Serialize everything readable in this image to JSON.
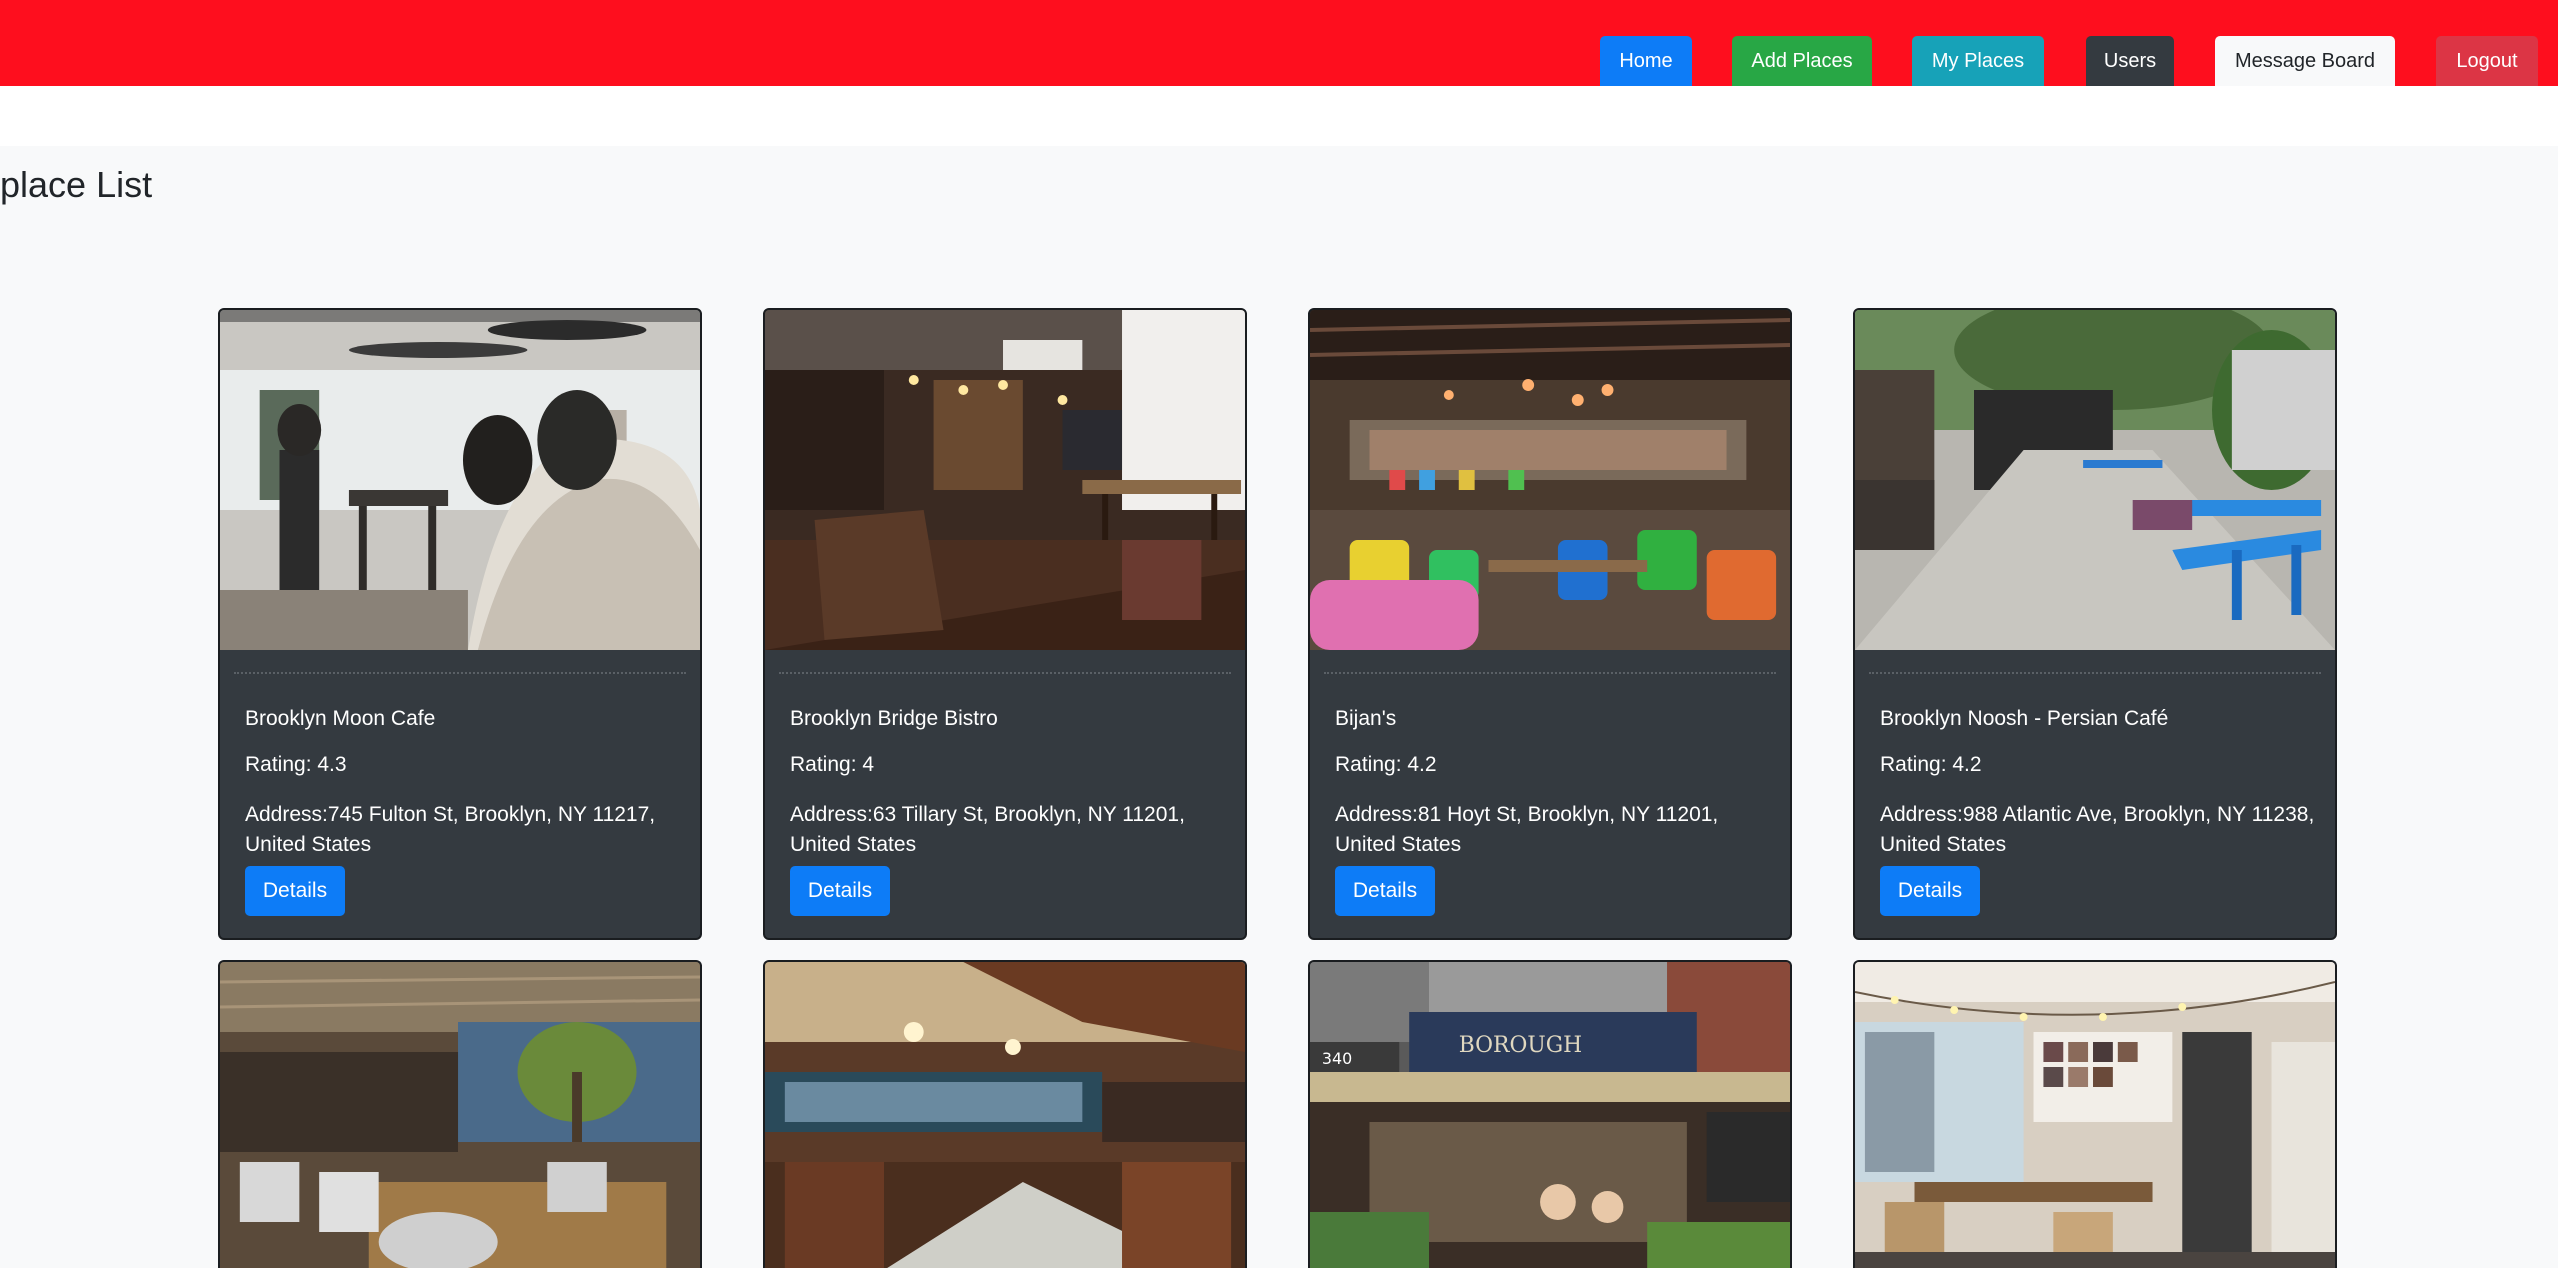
{
  "nav": {
    "home": "Home",
    "add_places": "Add Places",
    "my_places": "My Places",
    "users": "Users",
    "message_board": "Message Board",
    "logout": "Logout"
  },
  "page": {
    "title": "place List"
  },
  "places": [
    {
      "name": "Brooklyn Moon Cafe",
      "rating": "Rating: 4.3",
      "address": "Address:745 Fulton St, Brooklyn, NY 11217, United States",
      "details": "Details"
    },
    {
      "name": "Brooklyn Bridge Bistro",
      "rating": "Rating: 4",
      "address": "Address:63 Tillary St, Brooklyn, NY 11201, United States",
      "details": "Details"
    },
    {
      "name": "Bijan's",
      "rating": "Rating: 4.2",
      "address": "Address:81 Hoyt St, Brooklyn, NY 11201, United States",
      "details": "Details"
    },
    {
      "name": "Brooklyn Noosh - Persian Café",
      "rating": "Rating: 4.2",
      "address": "Address:988 Atlantic Ave, Brooklyn, NY 11238, United States",
      "details": "Details"
    }
  ],
  "photo_signs": {
    "storefront_number": "340",
    "storefront_name": "BOROUGH"
  },
  "colors": {
    "header": "#fe0e1e",
    "card": "#343a40",
    "primary": "#0d7cf7",
    "success": "#28a745",
    "info": "#17a2b8",
    "dark": "#343a40",
    "danger": "#dc3545"
  }
}
